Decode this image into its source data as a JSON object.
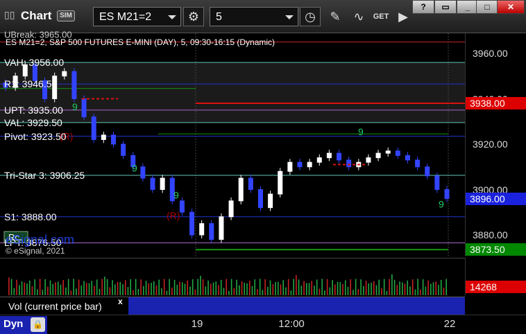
{
  "toolbar": {
    "title": "Chart",
    "sim_badge": "SIM",
    "symbol": "ES M21=2",
    "interval": "5",
    "get_label": "GET"
  },
  "chart": {
    "header": "ES M21=2, S&P 500 FUTURES E-MINI (DAY), 5, 09:30-16:15 (Dynamic)",
    "copyright": "© eSignal, 2021",
    "watermark": "eSignal.com",
    "top_label": "UBreak: 3965.00",
    "level_labels": [
      {
        "text": "VAH: 3956.00",
        "value": 3956.0
      },
      {
        "text": "R1: 3946.50",
        "value": 3946.5
      },
      {
        "text": "UPT: 3935.00",
        "value": 3935.0
      },
      {
        "text": "VAL: 3929.50",
        "value": 3929.5
      },
      {
        "text": "Pivot: 3923.50",
        "value": 3923.5
      },
      {
        "text": "Tri-Star 3: 3906.25",
        "value": 3906.25
      },
      {
        "text": "S1: 3888.00",
        "value": 3888.0
      },
      {
        "text": "LPT: 3876.50",
        "value": 3876.5
      }
    ],
    "markers": [
      "(R)",
      "(R)",
      "9",
      "9",
      "9",
      "9",
      "9",
      "Rc"
    ]
  },
  "price_axis": {
    "ticks": [
      "3960.00",
      "3940.00",
      "3920.00",
      "3900.00",
      "3880.00"
    ],
    "tags": [
      {
        "text": "3938.00",
        "color": "#dd0000",
        "value": 3938.0
      },
      {
        "text": "3896.00",
        "color": "#1a22dd",
        "value": 3896.0
      },
      {
        "text": "3873.50",
        "color": "#008800",
        "value": 3873.5
      }
    ]
  },
  "volume": {
    "label": "Vol (current price bar)",
    "close": "x",
    "value_tag": "14268",
    "value_color": "#dd0000"
  },
  "time_axis": {
    "labels": [
      "19",
      "12:00",
      "22"
    ]
  },
  "footer": {
    "dyn_label": "Dyn"
  },
  "chart_data": {
    "type": "line",
    "title": "ES M21=2, S&P 500 FUTURES E-MINI (DAY), 5, 09:30-16:15 (Dynamic)",
    "xlabel": "",
    "ylabel": "",
    "ylim": [
      3870,
      3970
    ],
    "x": [
      "19",
      "12:00",
      "22"
    ],
    "series": [
      {
        "values": [
          3945,
          3950,
          3955,
          3948,
          3940,
          3950,
          3952,
          3940,
          3932,
          3922,
          3924,
          3920,
          3915,
          3910,
          3905,
          3900,
          3905,
          3895,
          3890,
          3880,
          3885,
          3878,
          3888,
          3895,
          3905,
          3900,
          3892,
          3898,
          3908,
          3912,
          3910,
          3912,
          3914,
          3916,
          3913,
          3910,
          3912,
          3914,
          3916,
          3917,
          3915,
          3913,
          3910,
          3906,
          3900,
          3896
        ]
      }
    ]
  }
}
